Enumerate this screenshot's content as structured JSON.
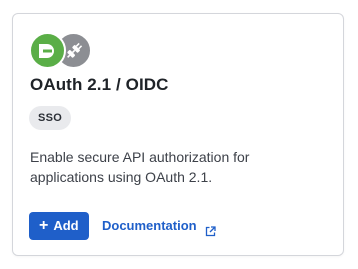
{
  "card": {
    "title": "OAuth 2.1 / OIDC",
    "badge": "SSO",
    "description": "Enable secure API authorization for applications using OAuth 2.1.",
    "add_button_label": "Add",
    "add_button_icon": "plus-icon",
    "documentation_link_label": "Documentation",
    "documentation_link_icon": "external-link-icon",
    "logos": [
      {
        "name": "primary-logo",
        "color": "#5aae47"
      },
      {
        "name": "plug-icon",
        "color": "#8c8e93"
      }
    ]
  },
  "colors": {
    "accent": "#1f5fc9",
    "badge_bg": "#e9eaed",
    "border": "#d4d6db"
  }
}
